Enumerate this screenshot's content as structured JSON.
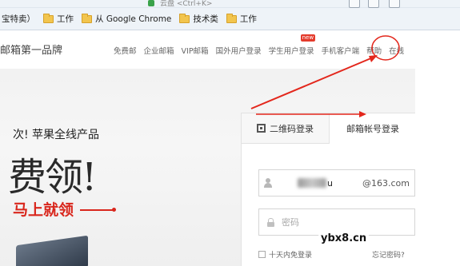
{
  "browser": {
    "url_fragment": "云盘 <Ctrl+K>",
    "bookmarks": [
      {
        "label": "宝特卖）"
      },
      {
        "label": "工作"
      },
      {
        "label": "从 Google Chrome"
      },
      {
        "label": "技术类"
      },
      {
        "label": "工作"
      }
    ]
  },
  "header": {
    "brand": "邮箱第一品牌",
    "nav": [
      {
        "label": "免费邮"
      },
      {
        "label": "企业邮箱"
      },
      {
        "label": "VIP邮箱"
      },
      {
        "label": "国外用户登录"
      },
      {
        "label": "学生用户登录",
        "badge": "new"
      },
      {
        "label": "手机客户端"
      },
      {
        "label": "帮助"
      },
      {
        "label": "在线"
      }
    ]
  },
  "hero": {
    "subtitle": "次! 苹果全线产品",
    "headline": "费领!",
    "cta": "马上就领"
  },
  "login": {
    "tab_qr": "二维码登录",
    "tab_account": "邮箱帐号登录",
    "username_value": "u",
    "domain_suffix": "@163.com",
    "password_placeholder": "密码",
    "remember_label": "十天内免登录",
    "forgot_label": "忘记密码?"
  },
  "watermark": "ybx8.cn",
  "colors": {
    "annotation_red": "#e3271c",
    "brand_red": "#d9261c",
    "badge_red": "#e43b2c"
  }
}
